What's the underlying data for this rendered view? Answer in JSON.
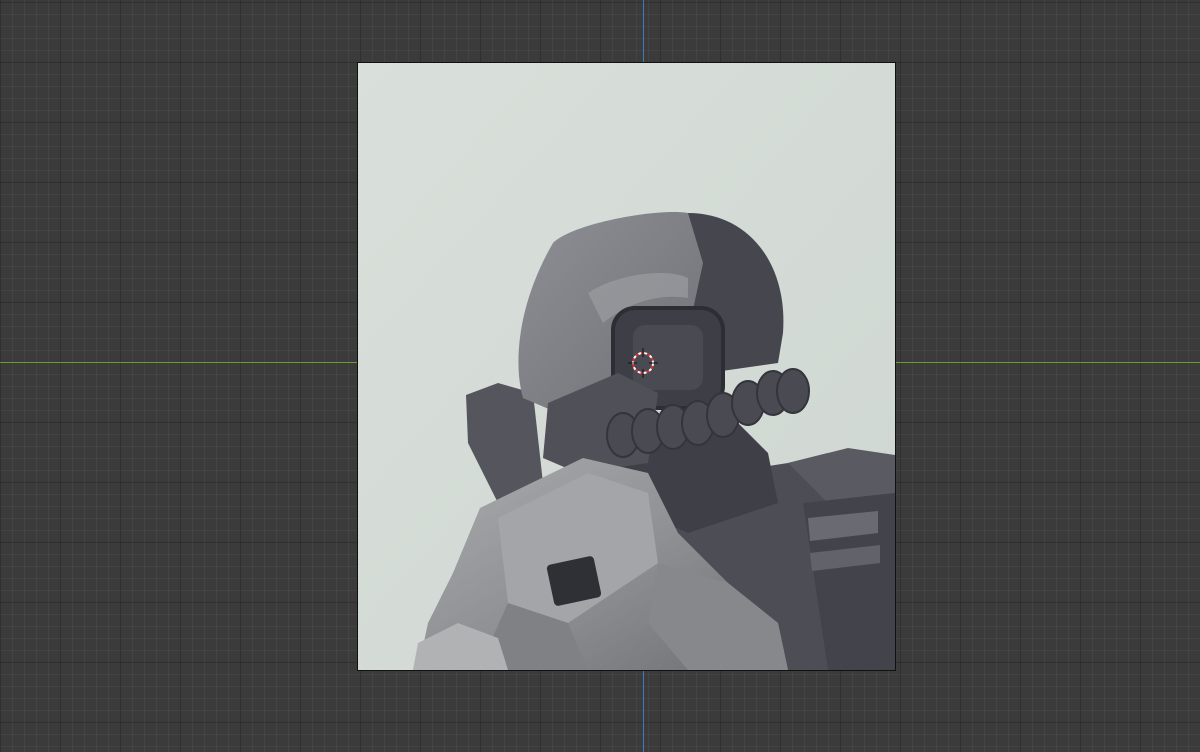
{
  "viewport": {
    "background_color": "#3b3b3b",
    "x_axis_color": "#6f9a2e",
    "y_axis_color": "#3f7ab8"
  },
  "reference_image": {
    "subject_icon": "robot-figure-helmet-image",
    "background_color": "#d6ddd8"
  },
  "cursor": {
    "icon": "3d-cursor-icon",
    "ring_color": "#e03030"
  }
}
